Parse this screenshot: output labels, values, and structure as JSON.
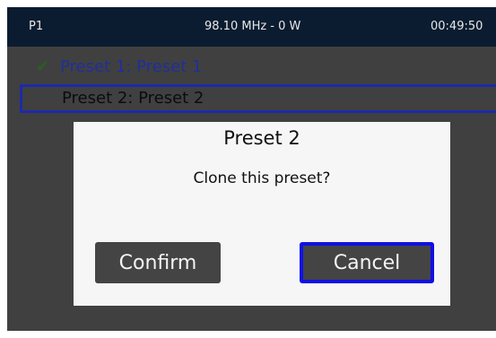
{
  "status_bar": {
    "preset": "P1",
    "frequency_power": "98.10 MHz - 0 W",
    "clock": "00:49:50"
  },
  "presets": [
    {
      "label": "Preset 1: Preset 1",
      "active": true,
      "icon": "check-icon"
    },
    {
      "label": "Preset 2: Preset 2",
      "active": false,
      "selected": true
    }
  ],
  "dialog": {
    "title": "Preset 2",
    "message": "Clone this preset?",
    "confirm_label": "Confirm",
    "cancel_label": "Cancel"
  },
  "colors": {
    "status_bar_bg": "#0b1c30",
    "screen_bg": "#404040",
    "active_preset_text": "#1f2f9c",
    "selection_border": "#1d2aa8",
    "focus_border": "#1010e6",
    "check_icon": "#2e5b26"
  }
}
